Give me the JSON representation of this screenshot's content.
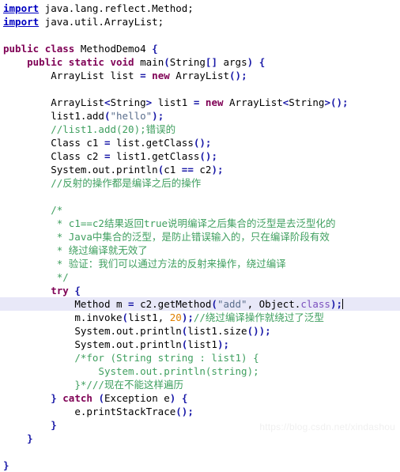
{
  "editor": {
    "language": "java",
    "background_color": "#ffffff",
    "current_line_highlight_color": "#e8e8f8",
    "colors": {
      "keyword": "#7f0055",
      "import": "#0000c0",
      "comment": "#3f9f5f",
      "string": "#5a6e8c",
      "number": "#e08000",
      "class_literal": "#7b4fbe",
      "bracket": "#1a1aa8",
      "plain": "#000000"
    }
  },
  "watermark": {
    "text": "https://blog.csdn.net/xindashou"
  },
  "code": {
    "l01": {
      "kw": "import",
      "rest": " java.lang.reflect.Method;"
    },
    "l02": {
      "kw": "import",
      "rest": " java.util.ArrayList;"
    },
    "l03": {
      "text": ""
    },
    "l04": {
      "a": "public",
      "b": " ",
      "c": "class",
      "d": " MethodDemo4 ",
      "e": "{"
    },
    "l05": {
      "indent": "    ",
      "a": "public",
      "b": " ",
      "c": "static",
      "d": " ",
      "e": "void",
      "f": " main",
      "g": "(",
      "h": "String",
      "i": "[]",
      "j": " args",
      "k": ")",
      "l": " ",
      "m": "{"
    },
    "l06": {
      "indent": "        ",
      "a": "ArrayList list ",
      "b": "=",
      "c": " ",
      "d": "new",
      "e": " ArrayList",
      "f": "()",
      "g": ";"
    },
    "l07": {
      "text": ""
    },
    "l08": {
      "indent": "        ",
      "a": "ArrayList",
      "b": "<",
      "c": "String",
      "d": ">",
      "e": " list1 ",
      "f": "=",
      "g": " ",
      "h": "new",
      "i": " ArrayList",
      "j": "<",
      "k": "String",
      "l": ">()",
      "m": ";"
    },
    "l09": {
      "indent": "        ",
      "a": "list1.add",
      "b": "(",
      "c": "\"hello\"",
      "d": ")",
      "e": ";"
    },
    "l10": {
      "indent": "        ",
      "cmt": "//list1.add(20);错误的"
    },
    "l11": {
      "indent": "        ",
      "a": "Class c1 ",
      "b": "=",
      "c": " list.getClass",
      "d": "()",
      "e": ";"
    },
    "l12": {
      "indent": "        ",
      "a": "Class c2 ",
      "b": "=",
      "c": " list1.getClass",
      "d": "()",
      "e": ";"
    },
    "l13": {
      "indent": "        ",
      "a": "System.out.println",
      "b": "(",
      "c": "c1 ",
      "d": "==",
      "e": " c2",
      "f": ")",
      "g": ";"
    },
    "l14": {
      "indent": "        ",
      "cmt": "//反射的操作都是编译之后的操作"
    },
    "l15": {
      "text": ""
    },
    "l16": {
      "indent": "        ",
      "cmt": "/*"
    },
    "l17": {
      "indent": "         ",
      "cmt": "* c1==c2结果返回true说明编译之后集合的泛型是去泛型化的"
    },
    "l18": {
      "indent": "         ",
      "cmt": "* Java中集合的泛型，是防止错误输入的，只在编译阶段有效"
    },
    "l19": {
      "indent": "         ",
      "cmt": "* 绕过编译就无效了"
    },
    "l20": {
      "indent": "         ",
      "cmt": "* 验证：我们可以通过方法的反射来操作，绕过编译"
    },
    "l21": {
      "indent": "         ",
      "cmt": "*/"
    },
    "l22": {
      "indent": "        ",
      "kw": "try",
      "rest": " ",
      "brace": "{"
    },
    "l23": {
      "indent": "            ",
      "a": "Method m ",
      "b": "=",
      "c": " c2.getMethod",
      "d": "(",
      "e": "\"add\"",
      "f": ", Object.",
      "g": "class",
      "h": ")",
      "i": ";",
      "caret": true
    },
    "l24": {
      "indent": "            ",
      "a": "m.invoke",
      "b": "(",
      "c": "list1, ",
      "d": "20",
      "e": ")",
      "f": ";",
      "cmt": "//绕过编译操作就绕过了泛型"
    },
    "l25": {
      "indent": "            ",
      "a": "System.out.println",
      "b": "(",
      "c": "list1.size",
      "d": "()",
      "e": ")",
      "f": ";"
    },
    "l26": {
      "indent": "            ",
      "a": "System.out.println",
      "b": "(",
      "c": "list1",
      "d": ")",
      "e": ";"
    },
    "l27": {
      "indent": "            ",
      "cmt": "/*for (String string : list1) {"
    },
    "l28": {
      "indent": "                ",
      "cmt": "System.out.println(string);"
    },
    "l29": {
      "indent": "            ",
      "cmt": "}*///现在不能这样遍历"
    },
    "l30": {
      "indent": "        ",
      "brace1": "}",
      "sp": " ",
      "kw": "catch",
      "mid": " ",
      "open": "(",
      "ex": "Exception e",
      "close": ")",
      "sp2": " ",
      "brace2": "{"
    },
    "l31": {
      "indent": "            ",
      "a": "e.printStackTrace",
      "b": "()",
      "c": ";"
    },
    "l32": {
      "indent": "        ",
      "brace": "}"
    },
    "l33": {
      "indent": "    ",
      "brace": "}"
    },
    "l34": {
      "text": ""
    },
    "l35": {
      "brace": "}"
    }
  }
}
